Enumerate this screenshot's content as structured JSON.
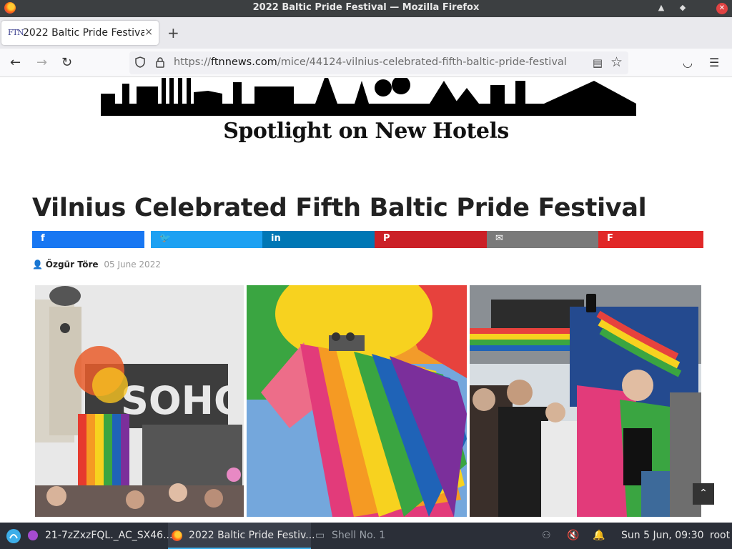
{
  "window": {
    "title": "2022 Baltic Pride Festival — Mozilla Firefox"
  },
  "tab": {
    "favicon": "FTN",
    "label": "2022 Baltic Pride Festival",
    "close": "×",
    "new_tab": "+"
  },
  "nav": {
    "back": "←",
    "forward": "→",
    "reload": "↻",
    "url_prefix": "https://",
    "url_host": "ftnnews.com",
    "url_path": "/mice/44124-vilnius-celebrated-fifth-baltic-pride-festival",
    "reader": "▤",
    "bookmark": "☆",
    "pocket": "◡",
    "menu": "☰"
  },
  "page": {
    "banner_text": "Spotlight on New Hotels",
    "headline": "Vilnius Celebrated Fifth Baltic Pride Festival",
    "share": [
      {
        "network": "facebook",
        "icon": "f",
        "color": "#1877f2"
      },
      {
        "network": "twitter",
        "icon": "🐦",
        "color": "#1da1f2"
      },
      {
        "network": "linkedin",
        "icon": "in",
        "color": "#0077b5"
      },
      {
        "network": "pinterest",
        "icon": "P",
        "color": "#cb2027"
      },
      {
        "network": "email",
        "icon": "✉",
        "color": "#7a7a7a"
      },
      {
        "network": "flipboard",
        "icon": "F",
        "color": "#e12828"
      }
    ],
    "author_icon": "👤",
    "author": "Özgür Töre",
    "date": "05 June 2022",
    "scroll_top": "⌃"
  },
  "taskbar": {
    "start_icon": "kde-icon",
    "items": [
      {
        "label": "21-7zZxzFQL._AC_SX46...",
        "active": false
      },
      {
        "label": "2022 Baltic Pride Festiv...",
        "active": true
      },
      {
        "label": "Shell No. 1",
        "active": false
      }
    ],
    "clock": "Sun  5 Jun, 09:30",
    "user": "root"
  }
}
